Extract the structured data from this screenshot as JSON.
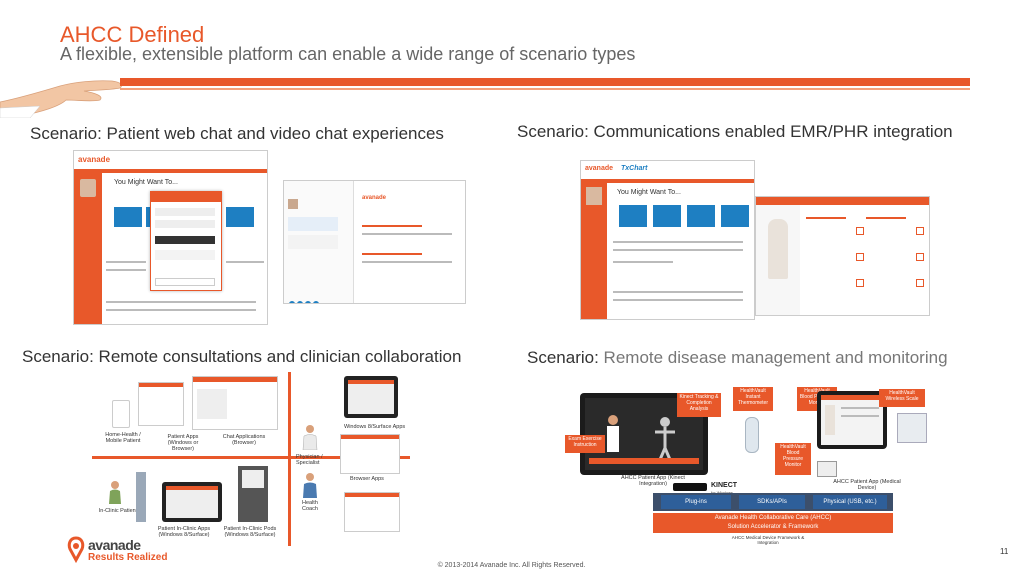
{
  "header": {
    "title": "AHCC Defined",
    "subtitle": "A flexible, extensible platform can enable a wide range of scenario types"
  },
  "scenarios": {
    "s1": "Scenario: Patient web chat and video chat experiences",
    "s2": "Scenario: Communications enabled EMR/PHR integration",
    "s3": "Scenario: Remote consultations and clinician collaboration",
    "s4_prefix": "Scenario:",
    "s4_rest": " Remote disease management and monitoring"
  },
  "s1_screen": {
    "heading": "You Might Want To...",
    "brand": "avanade"
  },
  "s2_screen": {
    "heading": "You Might Want To...",
    "brand": "avanade"
  },
  "s3_diagram": {
    "home_health": "Home-Health / Mobile Patient",
    "patient_apps": "Patient Apps (Windows or Browser)",
    "chat_apps": "Chat Applications (Browser)",
    "windows_surface": "Windows 8/Surface Apps",
    "physician": "Physician / Specialist",
    "browser_apps": "Browser Apps",
    "health_coach": "Health Coach",
    "in_clinic": "In-Clinic Patient",
    "in_clinic_apps": "Patient In-Clinic Apps (Windows 8/Surface)",
    "in_clinic_pods": "Patient In-Clinic Pods (Windows 8/Surface)"
  },
  "s4_diagram": {
    "kinect_tracking": "Kinect Tracking & Completion Analysis",
    "healthvault_thermo": "HealthVault Instant Thermometer",
    "healthvault_scale": "HealthVault Wireless Scale",
    "exercise": "Exam Exercise Instruction",
    "kinect_brand": "KINECT",
    "kinect_sub": "for Windows",
    "patient_app_kinect": "AHCC Patient App (Kinect Integration)",
    "bp_monitor": "HealthVault Blood Pressure Monitor",
    "patient_app_medical": "AHCC Patient App (Medical Device)",
    "plugins": "Plug-ins",
    "sdks": "SDKs/APIs",
    "physical": "Physical (USB, etc.)",
    "framework_line1": "Avanade Health Collaborative Care (AHCC)",
    "framework_line2": "Solution Accelerator & Framework",
    "device_framework": "AHCC Medical Device Framework & Integration"
  },
  "footer": {
    "logo": "avanade",
    "tagline": "Results Realized",
    "page_number": "11",
    "copyright": "© 2013-2014 Avanade Inc. All Rights Reserved."
  },
  "colors": {
    "accent": "#e8582a",
    "tile_blue": "#1e7fc2",
    "framework_blue": "#2e5f9a"
  }
}
